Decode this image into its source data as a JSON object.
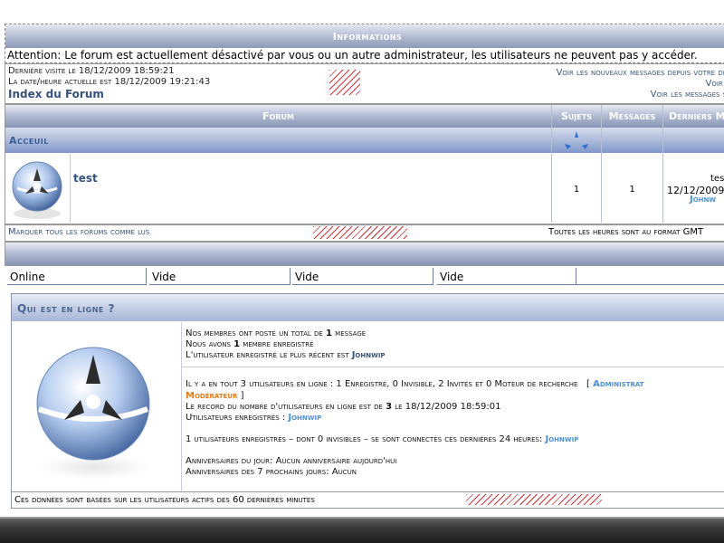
{
  "info": {
    "title": "Informations",
    "message": "Attention: Le forum est actuellement désactivé par vous ou un autre administrateur, les utilisateurs ne peuvent pas y accéder."
  },
  "visit": {
    "last_visit": "Dernière visite le 18/12/2009 18:59:21",
    "current_time": "La date/heure actuelle est 18/12/2009 19:21:43",
    "forum_index": "Index du Forum",
    "links": [
      "Voir les nouveaux messages depuis votre der",
      "Voir m",
      "Voir les messages sa"
    ]
  },
  "forum_table": {
    "headers": [
      "Forum",
      "Sujets",
      "Messages",
      "Derniers M"
    ],
    "category": "Acceuil",
    "row": {
      "name": "test",
      "topics": "1",
      "posts": "1",
      "last_post_line1": "tes",
      "last_post_line2": "12/12/2009",
      "last_post_user": "Johnw"
    }
  },
  "mark": {
    "mark_all": "Marquer tous les forums comme lus",
    "timezone": "Toutes les heures sont au format GMT"
  },
  "tabs": [
    "Online",
    "Vide",
    "Vide",
    "Vide"
  ],
  "online": {
    "title": "Qui est en ligne ?",
    "total_posts_pre": "Nos membres ont posté un total de",
    "total_posts": "1",
    "total_posts_post": "message",
    "members_pre": "Nous avons",
    "members": "1",
    "members_post": "membre enregistré",
    "newest_pre": "L'utilisateur enregistré le plus récent est",
    "newest_user": "Johnwip",
    "users_online_pre": "Il y a en tout",
    "users_online_count": "3",
    "users_online_post": "utilisateurs en ligne : 1 Enregistré, 0 Invisible, 2 Invités et 0 Moteur de recherche",
    "legend_admin": "Administrat",
    "legend_moderator": "Modérateur",
    "record_pre": "Le record du nombre d'utilisateurs en ligne est de",
    "record_count": "3",
    "record_post": "le 18/12/2009 18:59:01",
    "registered_pre": "Utilisateurs enregistrés :",
    "registered_user": "Johnwip",
    "last24_pre": "1 utilisateurs enregistrés – dont 0 invisibles – se sont connectés ces dernières 24 heures:",
    "last24_user": "Johnwip",
    "birthdays_today": "Anniversaires du jour: Aucun anniversaire aujourd'hui",
    "birthdays_week": "Anniversaires des 7 prochains jours: Aucun",
    "footer": "Ces données sont basées sur les utilisateurs actifs des 60 dernières minutes"
  },
  "colors": {
    "header_blue": "#8795b5",
    "category_blue": "#7f97cc",
    "link_blue": "#39547a",
    "user_blue": "#4d8fd0",
    "moderator_orange": "#e07a1c",
    "hatch_red": "#cc3333"
  },
  "icons": [
    "forum-status-icon",
    "online-sphere-icon",
    "sort-arrows-icon"
  ]
}
